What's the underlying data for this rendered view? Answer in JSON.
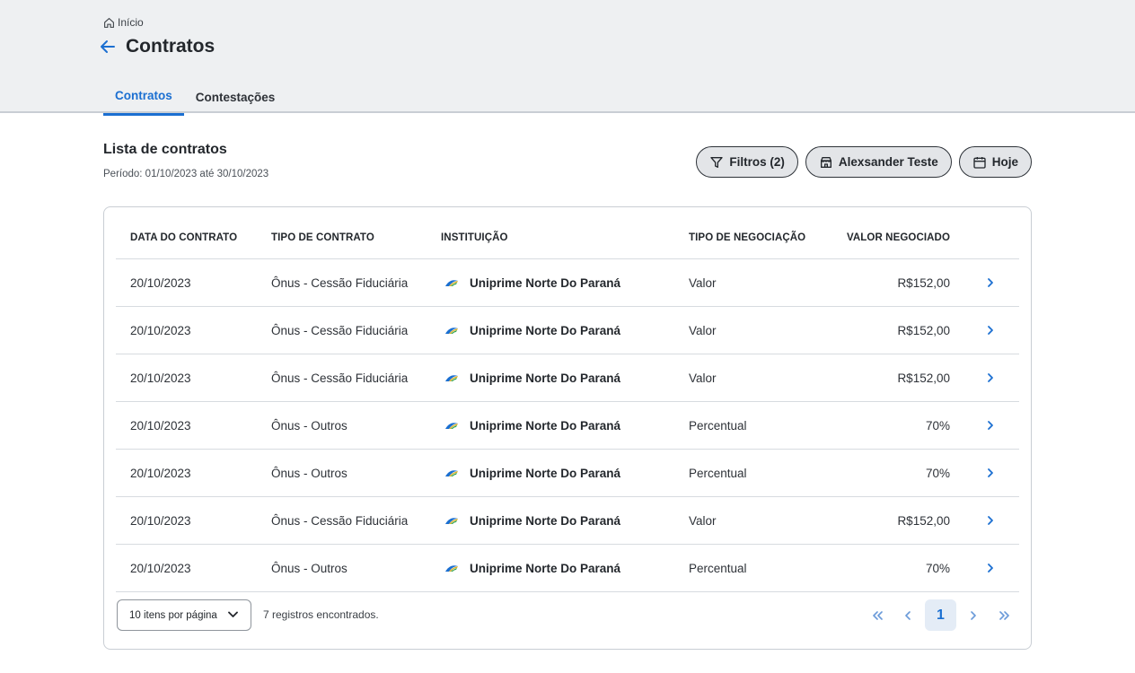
{
  "breadcrumb": {
    "label": "Início"
  },
  "page": {
    "title": "Contratos"
  },
  "tabs": [
    {
      "label": "Contratos",
      "active": true
    },
    {
      "label": "Contestações",
      "active": false
    }
  ],
  "list": {
    "title": "Lista de contratos",
    "period": "Período: 01/10/2023 até 30/10/2023"
  },
  "actions": {
    "filters_label": "Filtros (2)",
    "user_label": "Alexsander Teste",
    "date_label": "Hoje"
  },
  "table": {
    "headers": [
      "DATA DO CONTRATO",
      "TIPO DE CONTRATO",
      "INSTITUIÇÃO",
      "TIPO DE NEGOCIAÇÃO",
      "VALOR NEGOCIADO"
    ],
    "rows": [
      {
        "date": "20/10/2023",
        "type": "Ônus - Cessão Fiduciária",
        "institution": "Uniprime Norte Do Paraná",
        "negotiation": "Valor",
        "value": "R$152,00"
      },
      {
        "date": "20/10/2023",
        "type": "Ônus - Cessão Fiduciária",
        "institution": "Uniprime Norte Do Paraná",
        "negotiation": "Valor",
        "value": "R$152,00"
      },
      {
        "date": "20/10/2023",
        "type": "Ônus - Cessão Fiduciária",
        "institution": "Uniprime Norte Do Paraná",
        "negotiation": "Valor",
        "value": "R$152,00"
      },
      {
        "date": "20/10/2023",
        "type": "Ônus - Outros",
        "institution": "Uniprime Norte Do Paraná",
        "negotiation": "Percentual",
        "value": "70%"
      },
      {
        "date": "20/10/2023",
        "type": "Ônus - Outros",
        "institution": "Uniprime Norte Do Paraná",
        "negotiation": "Percentual",
        "value": "70%"
      },
      {
        "date": "20/10/2023",
        "type": "Ônus - Cessão Fiduciária",
        "institution": "Uniprime Norte Do Paraná",
        "negotiation": "Valor",
        "value": "R$152,00"
      },
      {
        "date": "20/10/2023",
        "type": "Ônus - Outros",
        "institution": "Uniprime Norte Do Paraná",
        "negotiation": "Percentual",
        "value": "70%"
      }
    ]
  },
  "pagination": {
    "per_page": "10 itens por página",
    "records": "7 registros encontrados.",
    "current_page": "1"
  },
  "colors": {
    "accent": "#1b6fd1",
    "header_bg": "#eef0f2",
    "pill_bg": "#e3e5e8",
    "active_page_bg": "#e4ecf6"
  },
  "icons": {
    "breadcrumb": "home-icon",
    "back": "arrow-left-icon",
    "filters": "filter-icon",
    "user": "store-icon",
    "date": "calendar-icon",
    "row_action": "chevron-right-icon",
    "institution_logo": "uniprime-logo-icon"
  }
}
